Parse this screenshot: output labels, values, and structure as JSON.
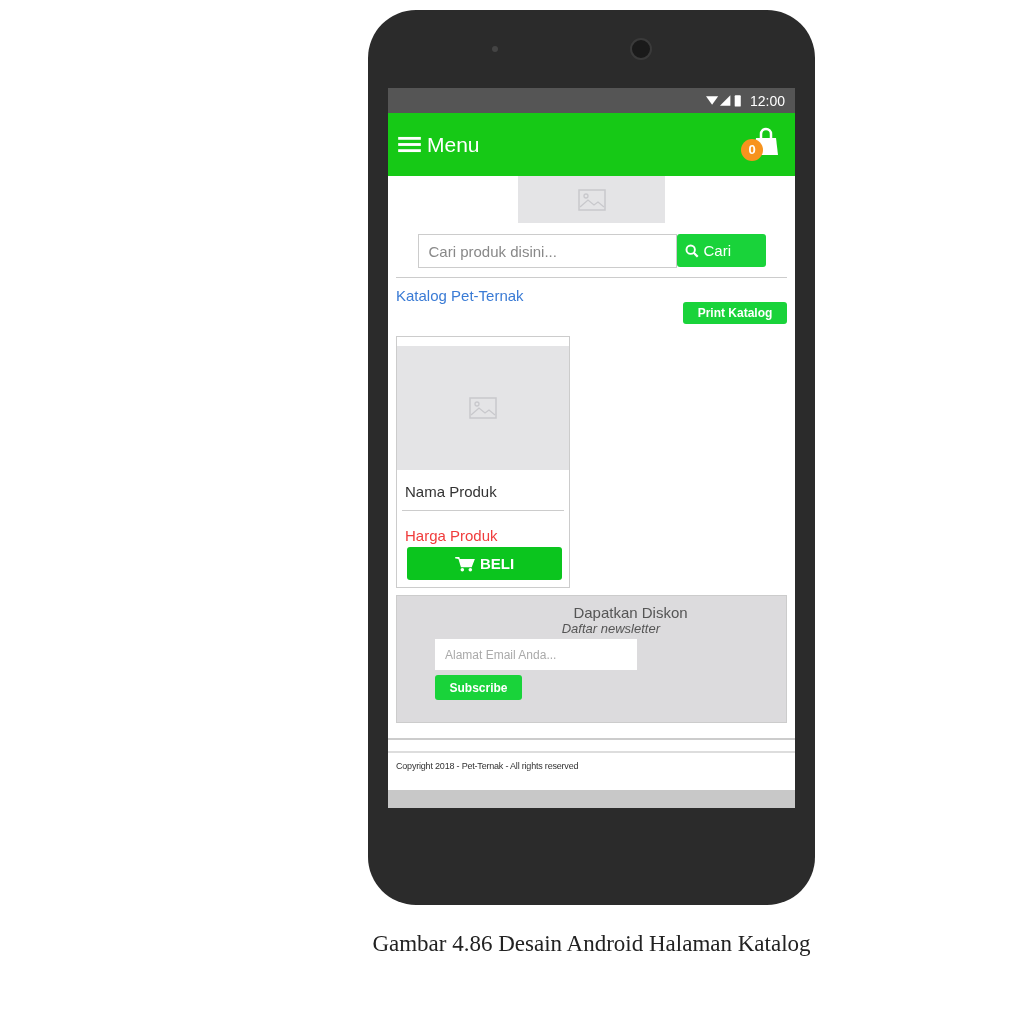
{
  "status_bar": {
    "time": "12:00"
  },
  "app_bar": {
    "title": "Menu",
    "cart_count": "0"
  },
  "search": {
    "placeholder": "Cari produk disini...",
    "button": "Cari"
  },
  "catalog": {
    "title": "Katalog Pet-Ternak",
    "print_button": "Print Katalog"
  },
  "products": [
    {
      "name": "Nama Produk",
      "price": "Harga Produk",
      "button": "BELI"
    }
  ],
  "newsletter": {
    "title": "Dapatkan Diskon",
    "subtitle": "Daftar newsletter",
    "placeholder": "Alamat Email Anda...",
    "button": "Subscribe"
  },
  "footer": "Copyright 2018 - Pet-Ternak - All rights reserved",
  "caption": "Gambar 4.86 Desain Android Halaman Katalog"
}
